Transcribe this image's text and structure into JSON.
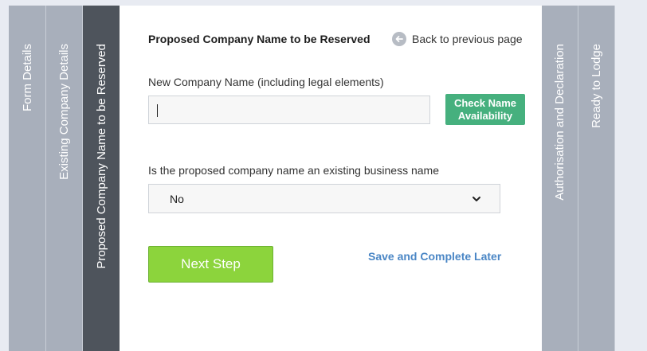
{
  "steps": [
    {
      "label": "Form Details",
      "active": false
    },
    {
      "label": "Existing Company Details",
      "active": false
    },
    {
      "label": "Proposed Company Name to be Reserved",
      "active": true
    },
    {
      "label": "Authorisation and Declaration",
      "active": false
    },
    {
      "label": "Ready to Lodge",
      "active": false
    }
  ],
  "section": {
    "title": "Proposed Company Name to be Reserved",
    "back_label": "Back to previous page"
  },
  "company_name": {
    "label": "New Company Name (including legal elements)",
    "value": "",
    "placeholder": ""
  },
  "check_button": {
    "line1": "Check Name",
    "line2": "Availability"
  },
  "existing_business": {
    "label": "Is the proposed company name an existing business name",
    "selected": "No"
  },
  "actions": {
    "next_label": "Next Step",
    "save_later_label": "Save and Complete Later"
  },
  "colors": {
    "active_tab": "#4e545c",
    "inactive_tab": "#a8afbb",
    "check_button": "#46b07e",
    "next_button": "#8cd43c",
    "link": "#4a86c5"
  },
  "icons": {
    "back": "arrow-left-circle-icon",
    "dropdown": "chevron-down-icon"
  }
}
